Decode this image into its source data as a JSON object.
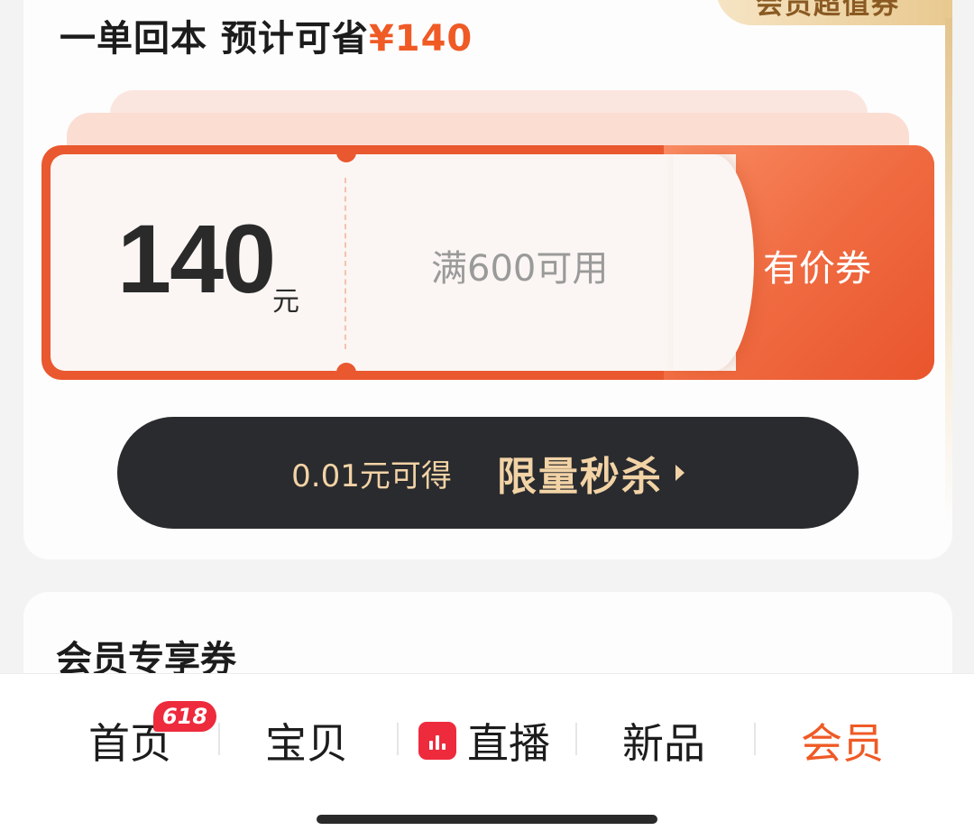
{
  "promo_card": {
    "corner_badge": "会员超值券",
    "headline_prefix": "一单回本 预计可省",
    "headline_price": "¥140"
  },
  "coupon": {
    "amount": "140",
    "unit": "元",
    "condition": "满600可用",
    "type_label": "有价券"
  },
  "flash_sale": {
    "price_text": "0.01元可得",
    "label": "限量秒杀"
  },
  "member_section": {
    "title": "会员专享券"
  },
  "tabbar": {
    "home": "首页",
    "home_badge": "618",
    "items": "宝贝",
    "live": "直播",
    "new": "新品",
    "member": "会员",
    "active_color": "#ef5a25"
  },
  "colors": {
    "accent": "#ef5a25",
    "flash_bg": "#2a2b2e",
    "flash_text": "#f2d3a6"
  }
}
